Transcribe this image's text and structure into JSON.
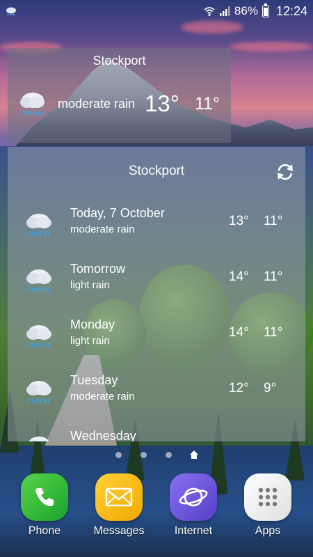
{
  "status_bar": {
    "battery": "86%",
    "time": "12:24",
    "icons": [
      "weather-notification-icon",
      "wifi-icon",
      "signal-icon",
      "battery-icon"
    ]
  },
  "small_widget": {
    "city": "Stockport",
    "condition": "moderate rain",
    "high": "13°",
    "low": "11°",
    "icon": "rain-cloud-icon"
  },
  "forecast": {
    "city": "Stockport",
    "refresh_icon": "refresh-icon",
    "days": [
      {
        "name": "Today, 7 October",
        "desc": "moderate rain",
        "high": "13°",
        "low": "11°",
        "icon": "rain-cloud-icon"
      },
      {
        "name": "Tomorrow",
        "desc": "light rain",
        "high": "14°",
        "low": "11°",
        "icon": "rain-cloud-icon"
      },
      {
        "name": "Monday",
        "desc": "light rain",
        "high": "14°",
        "low": "11°",
        "icon": "rain-cloud-icon"
      },
      {
        "name": "Tuesday",
        "desc": "moderate rain",
        "high": "12°",
        "low": "9°",
        "icon": "rain-cloud-icon"
      },
      {
        "name": "Wednesday",
        "desc": "",
        "high": "",
        "low": "",
        "icon": "rain-cloud-icon"
      }
    ]
  },
  "pager": {
    "pages": 4,
    "current": "home"
  },
  "dock": [
    {
      "label": "Phone",
      "icon": "phone-icon",
      "color": "#2fbf3a"
    },
    {
      "label": "Messages",
      "icon": "envelope-icon",
      "color": "#f5b800"
    },
    {
      "label": "Internet",
      "icon": "internet-planet-icon",
      "color": "#6b5bd6"
    },
    {
      "label": "Apps",
      "icon": "apps-grid-icon",
      "color": "#f2f2f2"
    }
  ]
}
